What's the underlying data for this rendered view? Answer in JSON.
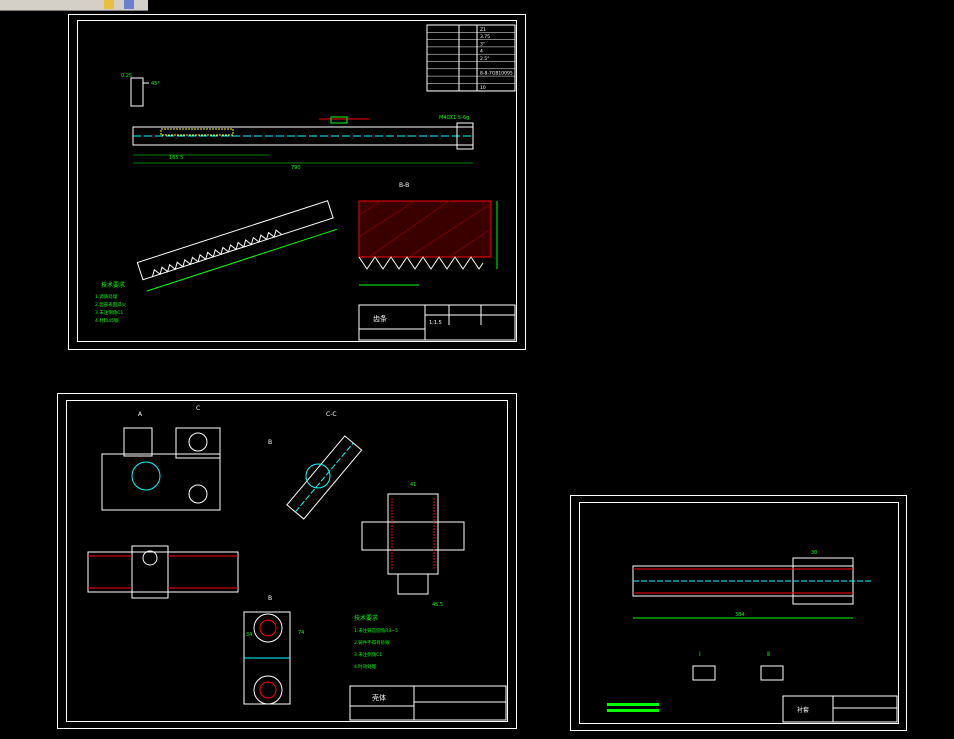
{
  "toolbar": {
    "icons": [
      "folder-icon",
      "cube-icon"
    ]
  },
  "colors": {
    "background": "#000000",
    "frame": "#ffffff",
    "dim": "#00ff00",
    "hatch": "#ff0000",
    "center": "#00ffff",
    "note": "#00ff00"
  },
  "sheet1": {
    "section_label": "B-B",
    "param_values": [
      "Z1",
      "3.75",
      "3°",
      "4",
      "2.5°",
      "",
      "8-8-7GB10095",
      "",
      "10"
    ],
    "dims": {
      "overall": "790",
      "left": "165.5",
      "nut_size": "M40X1.5-6g",
      "detail": "I"
    },
    "notes_title": "技术要求",
    "notes": [
      "1.调质处理",
      "2.齿部表面淬火",
      "3.未注倒角C1",
      "4.材料45钢"
    ],
    "title_block": {
      "name": "齿条",
      "scale": "1:1.5"
    }
  },
  "sheet2": {
    "section_labels": {
      "a": "A",
      "c": "C",
      "cc": "C-C",
      "b": "B",
      "bb": "B"
    },
    "notes_title": "技术要求",
    "notes": [
      "1.未注铸造圆角R3~5",
      "2.铸件不得有砂眼",
      "3.未注倒角C1",
      "4.时效处理"
    ],
    "dims": {
      "d1": "41",
      "d2": "45.5",
      "d3": "34",
      "d4": "74"
    },
    "title_block": {
      "name": "壳体"
    }
  },
  "sheet3": {
    "dims": {
      "total": "384",
      "d1": "30"
    },
    "details": [
      "Ⅰ",
      "Ⅱ"
    ],
    "title_block": {
      "name": "衬套"
    }
  }
}
